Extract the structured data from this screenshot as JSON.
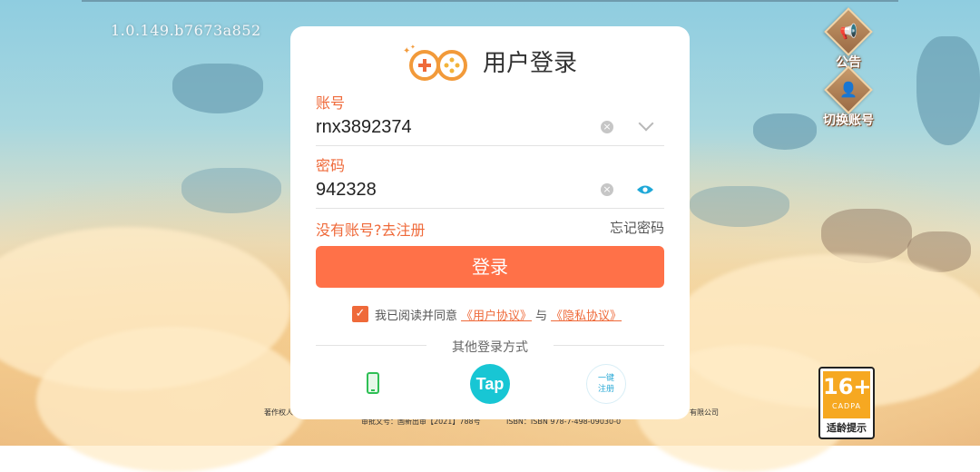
{
  "app": {
    "version": "1.0.149.b7673a852"
  },
  "side_buttons": {
    "announcement_label": "公告",
    "switch_account_label": "切换账号"
  },
  "login_dialog": {
    "title": "用户登录",
    "account_label": "账号",
    "account_value": "rnx3892374",
    "password_label": "密码",
    "password_value": "942328",
    "register_link": "没有账号?去注册",
    "forgot_link": "忘记密码",
    "login_button": "登录",
    "agreement_text": "我已阅读并同意",
    "user_agreement_link": "《用户协议》",
    "and_text": "与",
    "privacy_link": "《隐私协议》",
    "other_methods_label": "其他登录方式",
    "tap_label": "Tap",
    "quick_register_line1": "一键",
    "quick_register_line2": "注册"
  },
  "footer": {
    "copyright_left": "著作权人",
    "approval": "审批文号：国新出审【2021】788号",
    "isbn": "ISBN：ISBN 978-7-498-09030-0",
    "company_right": "有限公司"
  },
  "age_rating": {
    "number": "16+",
    "org": "CADPA",
    "tip": "适龄提示"
  },
  "colors": {
    "accent": "#ff7148",
    "tap": "#18c6d4"
  }
}
